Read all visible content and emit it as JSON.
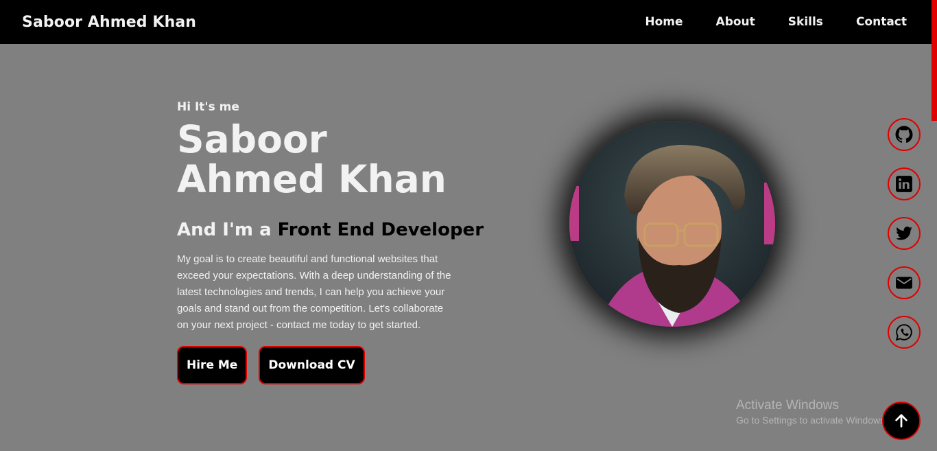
{
  "navbar": {
    "brand": "Saboor Ahmed Khan",
    "links": [
      {
        "label": "Home"
      },
      {
        "label": "About"
      },
      {
        "label": "Skills"
      },
      {
        "label": "Contact"
      }
    ]
  },
  "hero": {
    "greeting": "Hi It's me",
    "name": "Saboor Ahmed Khan",
    "role_prefix": "And I'm a ",
    "role_highlight": "Front End Developer",
    "description": "My goal is to create beautiful and functional websites that exceed your expectations. With a deep understanding of the latest technologies and trends, I can help you achieve your goals and stand out from the competition. Let's collaborate on your next project - contact me today to get started.",
    "buttons": {
      "hire": "Hire Me",
      "download": "Download CV"
    }
  },
  "social": [
    {
      "icon": "github-icon"
    },
    {
      "icon": "linkedin-icon"
    },
    {
      "icon": "twitter-icon"
    },
    {
      "icon": "email-icon"
    },
    {
      "icon": "whatsapp-icon"
    }
  ],
  "watermark": {
    "title": "Activate Windows",
    "subtitle": "Go to Settings to activate Windows."
  },
  "colors": {
    "background": "#808080",
    "navbar": "#000000",
    "accent": "#e00000",
    "text": "#f2f2f2"
  }
}
